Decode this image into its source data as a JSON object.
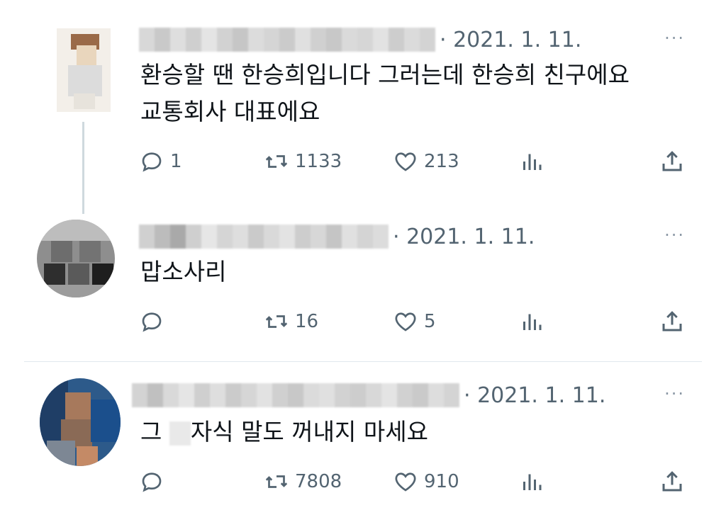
{
  "tweets": [
    {
      "date": "· 2021. 1. 11.",
      "text_lines": [
        "환승할 땐 한승희입니다 그러는데 한승희 친구에요",
        "교통회사 대표에요"
      ],
      "replies": "1",
      "retweets": "1133",
      "likes": "213"
    },
    {
      "date": "· 2021. 1. 11.",
      "text_lines": [
        "맙소사리"
      ],
      "replies": "",
      "retweets": "16",
      "likes": "5"
    },
    {
      "date": "· 2021. 1. 11.",
      "text_before": "그 ",
      "text_after": "자식 말도 꺼내지 마세요",
      "replies": "",
      "retweets": "7808",
      "likes": "910"
    }
  ],
  "icons": {
    "reply": "reply-icon",
    "retweet": "retweet-icon",
    "like": "heart-icon",
    "views": "analytics-icon",
    "share": "share-icon",
    "more": "more-icon"
  },
  "more_glyph": "···",
  "colors": {
    "text": "#0f1419",
    "muted": "#536471",
    "line": "#cfd9de"
  }
}
